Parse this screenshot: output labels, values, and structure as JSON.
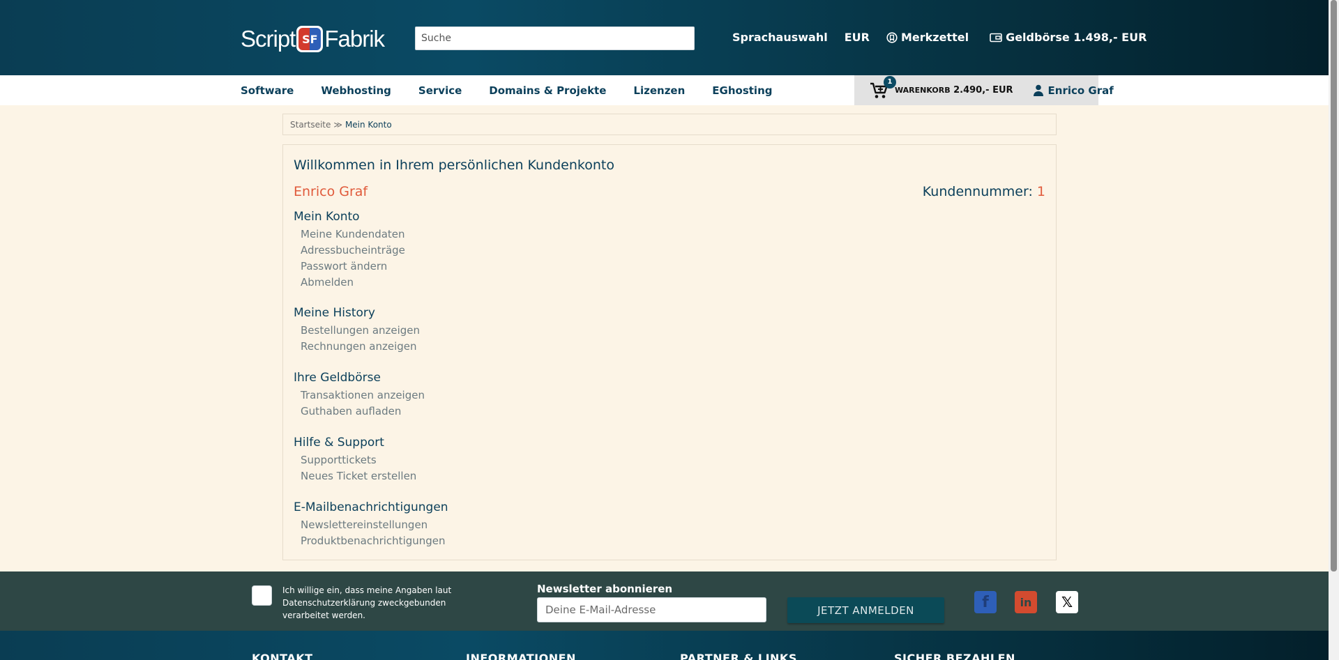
{
  "header": {
    "logo": {
      "part1": "Script",
      "mark": "SF",
      "part2": "Fabrik"
    },
    "search_placeholder": "Suche",
    "language_label": "Sprachauswahl",
    "currency_label": "EUR",
    "wishlist_label": "Merkzettel",
    "wallet_label": "Geldbörse 1.498,- EUR"
  },
  "nav": {
    "items": [
      "Software",
      "Webhosting",
      "Service",
      "Domains & Projekte",
      "Lizenzen",
      "EGhosting"
    ],
    "cart": {
      "count": "1",
      "label": "WARENKORB",
      "amount": "2.490,- EUR"
    },
    "user_label": "Enrico Graf"
  },
  "breadcrumb": {
    "home": "Startseite",
    "separator": "≫",
    "current": "Mein Konto"
  },
  "account": {
    "welcome": "Willkommen in Ihrem persönlichen Kundenkonto",
    "user_name": "Enrico Graf",
    "customer_number_label": "Kundennummer:",
    "customer_number": "1",
    "sections": [
      {
        "title": "Mein Konto",
        "items": [
          "Meine Kundendaten",
          "Adressbucheinträge",
          "Passwort ändern",
          "Abmelden"
        ]
      },
      {
        "title": "Meine History",
        "items": [
          "Bestellungen anzeigen",
          "Rechnungen anzeigen"
        ]
      },
      {
        "title": "Ihre Geldbörse",
        "items": [
          "Transaktionen anzeigen",
          "Guthaben aufladen"
        ]
      },
      {
        "title": "Hilfe & Support",
        "items": [
          "Supporttickets",
          "Neues Ticket erstellen"
        ]
      },
      {
        "title": "E-Mailbenachrichtigungen",
        "items": [
          "Newslettereinstellungen",
          "Produktbenachrichtigungen"
        ]
      }
    ]
  },
  "newsletter": {
    "consent_text": "Ich willige ein, dass meine Angaben laut Datenschutzerklärung zweckgebunden verarbeitet werden.",
    "title": "Newsletter abonnieren",
    "email_placeholder": "Deine E-Mail-Adresse",
    "button_label": "JETZT ANMELDEN",
    "social": {
      "facebook": "f",
      "linkedin": "in",
      "x": "𝕏"
    }
  },
  "footer": {
    "headings": [
      "KONTAKT",
      "INFORMATIONEN",
      "PARTNER & LINKS",
      "SICHER BEZAHLEN"
    ]
  },
  "colors": {
    "primary": "#0b3f5a",
    "accent": "#e05a3b",
    "background": "#fcf4e6",
    "newsletter_band": "#2e4745"
  },
  "icons": {
    "wishlist": "bookmark-circle-icon",
    "wallet": "wallet-icon",
    "cart": "cart-plus-icon",
    "user": "user-icon"
  }
}
